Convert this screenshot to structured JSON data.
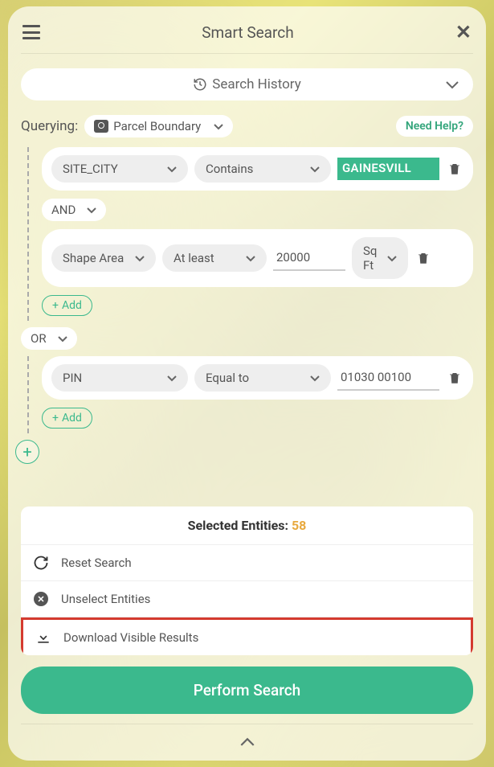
{
  "header": {
    "title": "Smart Search"
  },
  "searchHistory": {
    "label": "Search History"
  },
  "querying": {
    "label": "Querying:",
    "layer": "Parcel Boundary",
    "needHelp": "Need Help?"
  },
  "group1": {
    "cond1": {
      "field": "SITE_CITY",
      "op": "Contains",
      "value": "GAINESVILL"
    },
    "logic": "AND",
    "cond2": {
      "field": "Shape Area",
      "op": "At least",
      "value": "20000",
      "unit": "Sq Ft"
    },
    "add": "Add"
  },
  "orLogic": "OR",
  "group2": {
    "cond1": {
      "field": "PIN",
      "op": "Equal to",
      "value": "01030 00100"
    },
    "add": "Add"
  },
  "results": {
    "label": "Selected Entities:",
    "count": "58",
    "reset": "Reset Search",
    "unselect": "Unselect Entities",
    "download": "Download Visible Results"
  },
  "perform": "Perform Search"
}
